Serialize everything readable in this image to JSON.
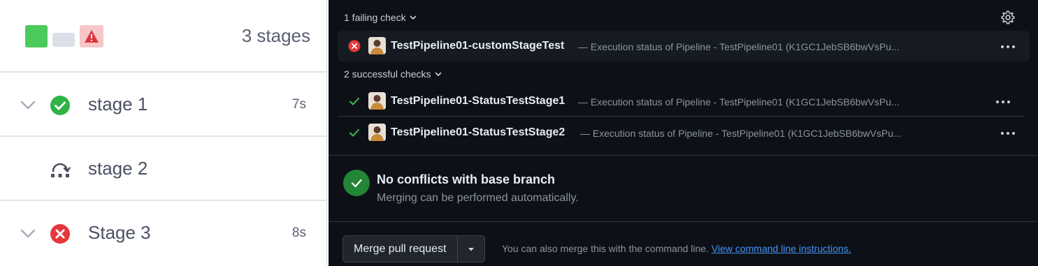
{
  "pipeline": {
    "stages_count": "3 stages",
    "stages": [
      {
        "name": "stage 1",
        "duration": "7s",
        "status": "success"
      },
      {
        "name": "stage 2",
        "duration": "",
        "status": "skipped"
      },
      {
        "name": "Stage 3",
        "duration": "8s",
        "status": "failed"
      }
    ]
  },
  "checks": {
    "failing_label": "1 failing check",
    "successful_label": "2 successful checks",
    "failing": [
      {
        "name": "TestPipeline01-customStageTest",
        "description": "— Execution status of Pipeline - TestPipeline01 (K1GC1JebSB6bwVsPu..."
      }
    ],
    "successful": [
      {
        "name": "TestPipeline01-StatusTestStage1",
        "description": "— Execution status of Pipeline - TestPipeline01 (K1GC1JebSB6bwVsPu..."
      },
      {
        "name": "TestPipeline01-StatusTestStage2",
        "description": "— Execution status of Pipeline - TestPipeline01 (K1GC1JebSB6bwVsPu..."
      }
    ]
  },
  "merge_status": {
    "title": "No conflicts with base branch",
    "subtitle": "Merging can be performed automatically."
  },
  "merge": {
    "button_label": "Merge pull request",
    "note": "You can also merge this with the command line.",
    "link": "View command line instructions."
  },
  "colors": {
    "success": "#4ccb5c",
    "failure": "#e5383b",
    "dark_bg": "#0d1117",
    "link": "#4493f8"
  }
}
